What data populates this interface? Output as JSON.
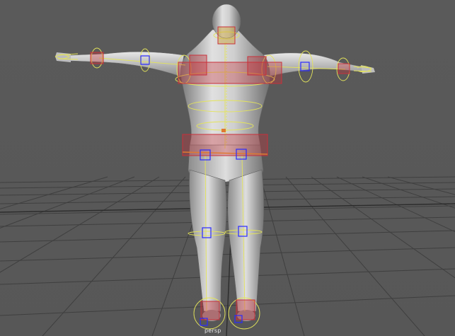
{
  "viewport": {
    "camera_name": "persp"
  },
  "colors": {
    "background": "#595959",
    "grid_line": "#3f3f3f",
    "grid_axis": "#2e2e2e",
    "body_light": "#dcdcdc",
    "body_mid": "#a9a9a9",
    "body_dark": "#6e6e6e",
    "control_curve": "#e4e45a",
    "fk_box": "#2a2aff",
    "ik_box": "#c9303a",
    "ik_fill": "#c9303a"
  },
  "icons": {
    "rig_controls": [
      "yellow-nurbs-curve",
      "blue-joint-cube",
      "red-ik-cube"
    ]
  }
}
